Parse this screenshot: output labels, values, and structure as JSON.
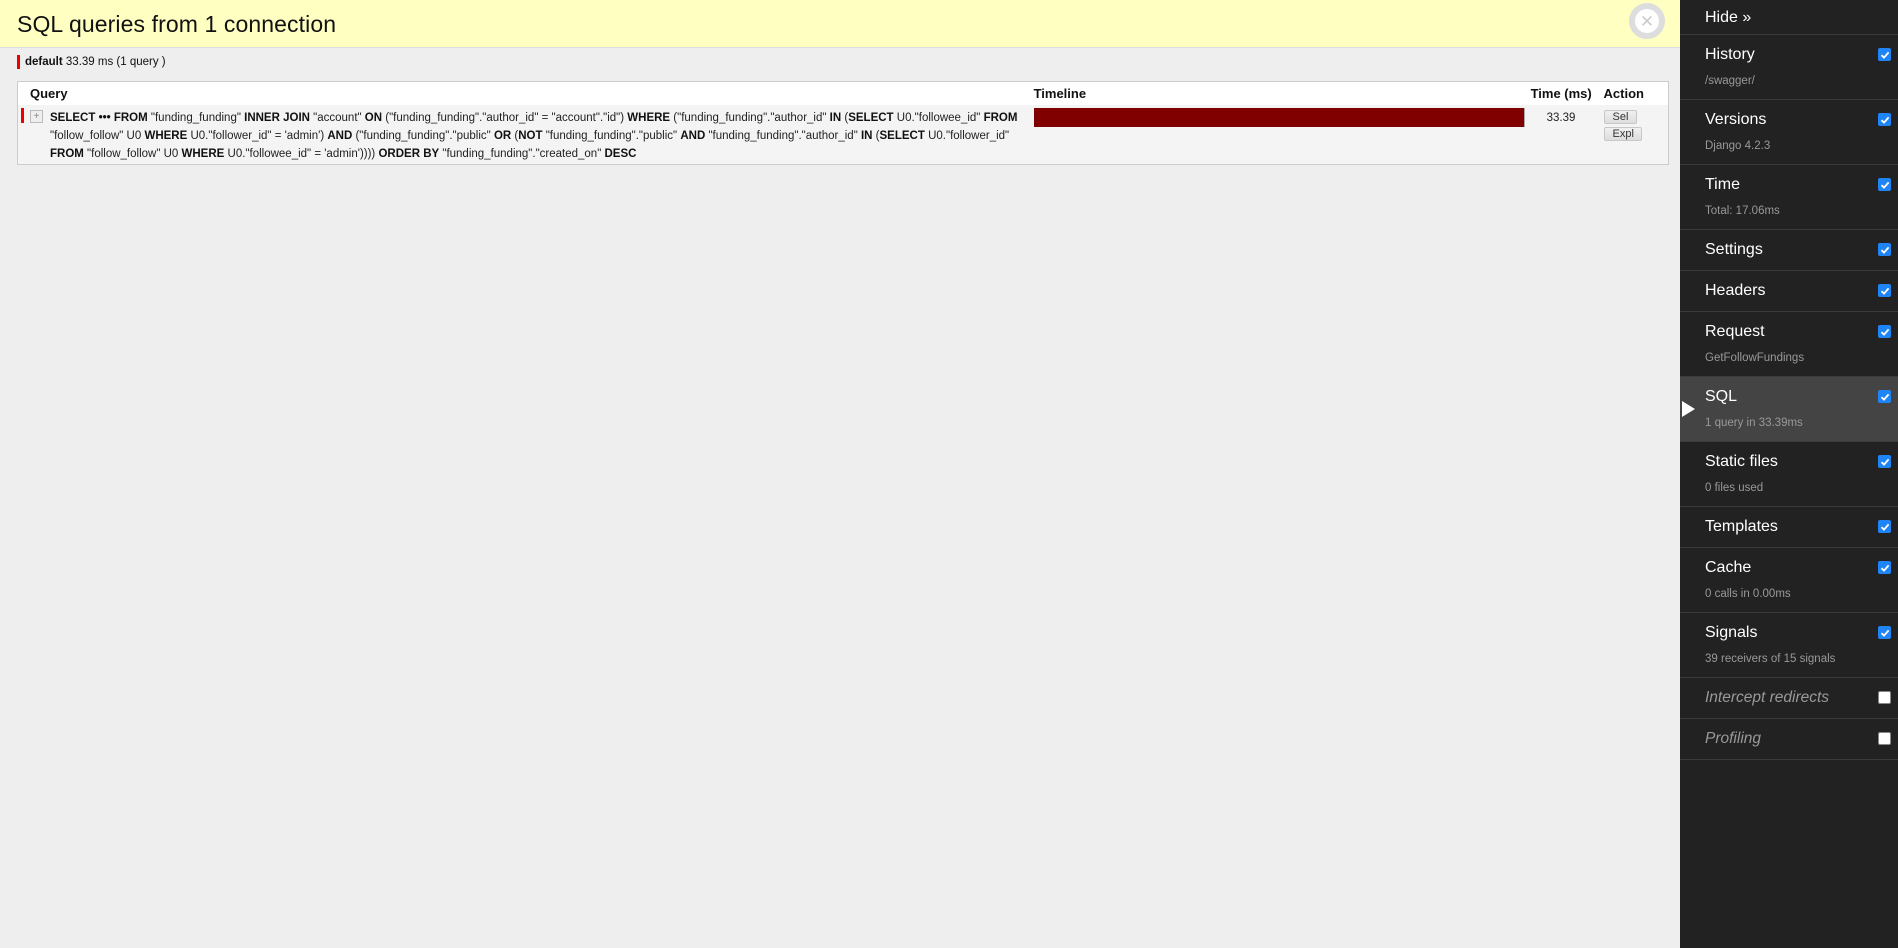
{
  "panel": {
    "title": "SQL queries from 1 connection",
    "close_icon": "close-icon",
    "connection": {
      "name": "default",
      "summary": "33.39 ms (1 query )",
      "color": "#ee0000"
    },
    "table": {
      "headers": {
        "query": "Query",
        "timeline": "Timeline",
        "time": "Time (ms)",
        "action": "Action"
      },
      "rows": [
        {
          "toggle": "+",
          "sql_segments": [
            {
              "t": "SELECT",
              "b": true
            },
            {
              "t": " ••• ",
              "b": true
            },
            {
              "t": "FROM",
              "b": true
            },
            {
              "t": " \"funding_funding\" ",
              "b": false
            },
            {
              "t": "INNER JOIN",
              "b": true
            },
            {
              "t": " \"account\" ",
              "b": false
            },
            {
              "t": "ON",
              "b": true
            },
            {
              "t": " (\"funding_funding\".\"author_id\" = \"account\".\"id\") ",
              "b": false
            },
            {
              "t": "WHERE",
              "b": true
            },
            {
              "t": " (\"funding_funding\".\"author_id\" ",
              "b": false
            },
            {
              "t": "IN",
              "b": true
            },
            {
              "t": " (",
              "b": false
            },
            {
              "t": "SELECT",
              "b": true
            },
            {
              "t": " U0.\"followee_id\" ",
              "b": false
            },
            {
              "t": "FROM",
              "b": true
            },
            {
              "t": " \"follow_follow\" U0 ",
              "b": false
            },
            {
              "t": "WHERE",
              "b": true
            },
            {
              "t": " U0.\"follower_id\" = 'admin') ",
              "b": false
            },
            {
              "t": "AND",
              "b": true
            },
            {
              "t": " (\"funding_funding\".\"public\" ",
              "b": false
            },
            {
              "t": "OR",
              "b": true
            },
            {
              "t": " (",
              "b": false
            },
            {
              "t": "NOT",
              "b": true
            },
            {
              "t": " \"funding_funding\".\"public\" ",
              "b": false
            },
            {
              "t": "AND",
              "b": true
            },
            {
              "t": " \"funding_funding\".\"author_id\" ",
              "b": false
            },
            {
              "t": "IN",
              "b": true
            },
            {
              "t": " (",
              "b": false
            },
            {
              "t": "SELECT",
              "b": true
            },
            {
              "t": " U0.\"follower_id\" ",
              "b": false
            },
            {
              "t": "FROM",
              "b": true
            },
            {
              "t": " \"follow_follow\" U0 ",
              "b": false
            },
            {
              "t": "WHERE",
              "b": true
            },
            {
              "t": " U0.\"followee_id\" = 'admin')))) ",
              "b": false
            },
            {
              "t": "ORDER BY",
              "b": true
            },
            {
              "t": " \"funding_funding\".\"created_on\" ",
              "b": false
            },
            {
              "t": "DESC",
              "b": true
            }
          ],
          "timeline_fraction": 1.0,
          "timeline_color": "#800000",
          "time_ms": "33.39",
          "actions": [
            "Sel",
            "Expl"
          ]
        }
      ]
    }
  },
  "toolbar": {
    "hide_label": "Hide »",
    "items": [
      {
        "key": "history",
        "label": "History",
        "sub": "/swagger/",
        "checked": true,
        "active": false,
        "disabled": false
      },
      {
        "key": "versions",
        "label": "Versions",
        "sub": "Django 4.2.3",
        "checked": true,
        "active": false,
        "disabled": false
      },
      {
        "key": "time",
        "label": "Time",
        "sub": "Total: 17.06ms",
        "checked": true,
        "active": false,
        "disabled": false
      },
      {
        "key": "settings",
        "label": "Settings",
        "sub": null,
        "checked": true,
        "active": false,
        "disabled": false
      },
      {
        "key": "headers",
        "label": "Headers",
        "sub": null,
        "checked": true,
        "active": false,
        "disabled": false
      },
      {
        "key": "request",
        "label": "Request",
        "sub": "GetFollowFundings",
        "checked": true,
        "active": false,
        "disabled": false
      },
      {
        "key": "sql",
        "label": "SQL",
        "sub": "1 query in 33.39ms",
        "checked": true,
        "active": true,
        "disabled": false
      },
      {
        "key": "static-files",
        "label": "Static files",
        "sub": "0 files used",
        "checked": true,
        "active": false,
        "disabled": false
      },
      {
        "key": "templates",
        "label": "Templates",
        "sub": null,
        "checked": true,
        "active": false,
        "disabled": false
      },
      {
        "key": "cache",
        "label": "Cache",
        "sub": "0 calls in 0.00ms",
        "checked": true,
        "active": false,
        "disabled": false
      },
      {
        "key": "signals",
        "label": "Signals",
        "sub": "39 receivers of 15 signals",
        "checked": true,
        "active": false,
        "disabled": false
      },
      {
        "key": "intercept-redirects",
        "label": "Intercept redirects",
        "sub": null,
        "checked": false,
        "active": false,
        "disabled": true
      },
      {
        "key": "profiling",
        "label": "Profiling",
        "sub": null,
        "checked": false,
        "active": false,
        "disabled": true
      }
    ]
  }
}
